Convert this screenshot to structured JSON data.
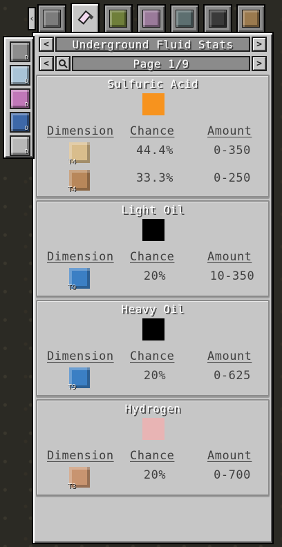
{
  "tabs": [
    {
      "icon": "gray-machine-block-icon",
      "active": false
    },
    {
      "icon": "chemical-flask-icon",
      "active": true
    },
    {
      "icon": "green-wood-crate-icon",
      "active": false
    },
    {
      "icon": "pink-machine-block-icon",
      "active": false
    },
    {
      "icon": "teal-machine-block-icon",
      "active": false
    },
    {
      "icon": "dark-machine-block-icon",
      "active": false
    },
    {
      "icon": "wood-crate-icon",
      "active": false
    }
  ],
  "side_slots": [
    {
      "icon": "gray-drill-block-icon",
      "mark": "D"
    },
    {
      "icon": "light-blue-drill-block-icon",
      "mark": "D"
    },
    {
      "icon": "pink-drill-block-icon",
      "mark": "D"
    },
    {
      "icon": "blue-drill-block-icon",
      "mark": "D"
    },
    {
      "icon": "white-drill-block-icon",
      "mark": "D"
    }
  ],
  "header": {
    "title": "Underground Fluid Stats",
    "prev": "<",
    "next": ">"
  },
  "pager": {
    "label": "Page 1/9",
    "prev": "<",
    "next": ">"
  },
  "columns": {
    "dimension": "Dimension",
    "chance": "Chance",
    "amount": "Amount"
  },
  "fluids": [
    {
      "name": "Sulfuric Acid",
      "color": "#f7931e",
      "rows": [
        {
          "tier": "T4",
          "planet_color": "#d9bd8c",
          "chance": "44.4%",
          "amount": "0-350"
        },
        {
          "tier": "T4",
          "planet_color": "#b8875a",
          "chance": "33.3%",
          "amount": "0-250"
        }
      ]
    },
    {
      "name": "Light Oil",
      "color": "#000000",
      "rows": [
        {
          "tier": "T9",
          "planet_color": "#3b7fc4",
          "chance": "20%",
          "amount": "10-350"
        }
      ]
    },
    {
      "name": "Heavy Oil",
      "color": "#000000",
      "rows": [
        {
          "tier": "T9",
          "planet_color": "#3b7fc4",
          "chance": "20%",
          "amount": "0-625"
        }
      ]
    },
    {
      "name": "Hydrogen",
      "color": "#e8b4b4",
      "rows": [
        {
          "tier": "T3",
          "planet_color": "#c89470",
          "chance": "20%",
          "amount": "0-700"
        }
      ]
    }
  ]
}
